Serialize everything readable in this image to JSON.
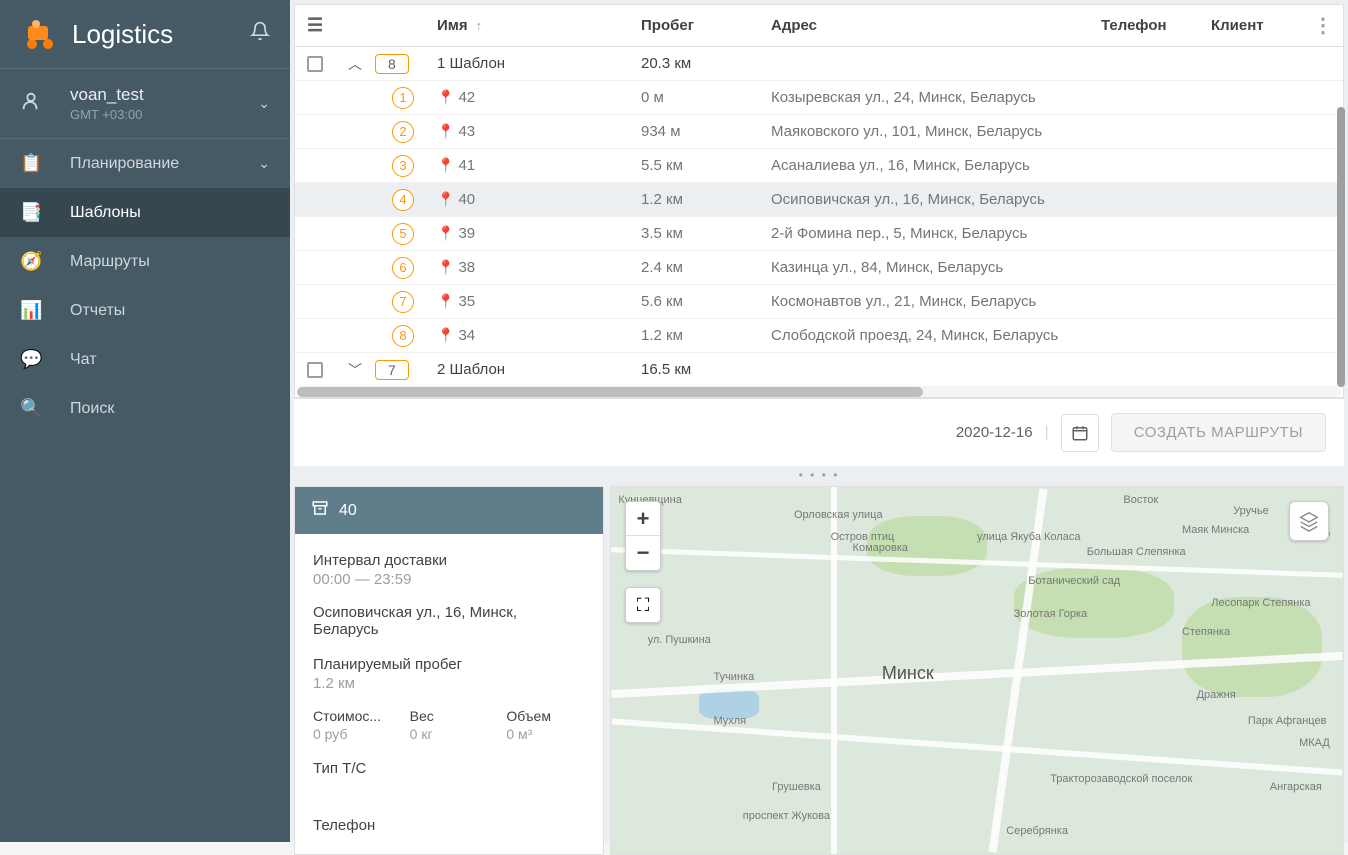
{
  "app": {
    "title": "Logistics"
  },
  "user": {
    "name": "voan_test",
    "tz": "GMT +03:00"
  },
  "nav": {
    "planning": "Планирование",
    "templates": "Шаблоны",
    "routes": "Маршруты",
    "reports": "Отчеты",
    "chat": "Чат",
    "search": "Поиск"
  },
  "table": {
    "headers": {
      "name": "Имя",
      "mileage": "Пробег",
      "address": "Адрес",
      "phone": "Телефон",
      "client": "Клиент"
    },
    "groups": [
      {
        "badge": "8",
        "name": "1 Шаблон",
        "mileage": "20.3 км",
        "expanded": true,
        "rows": [
          {
            "n": "1",
            "name": "42",
            "mileage": "0 м",
            "address": "Козыревская ул., 24, Минск, Беларусь"
          },
          {
            "n": "2",
            "name": "43",
            "mileage": "934 м",
            "address": "Маяковского ул., 101, Минск, Беларусь"
          },
          {
            "n": "3",
            "name": "41",
            "mileage": "5.5 км",
            "address": "Асаналиева ул., 16, Минск, Беларусь"
          },
          {
            "n": "4",
            "name": "40",
            "mileage": "1.2 км",
            "address": "Осиповичская ул., 16, Минск, Беларусь",
            "hl": true
          },
          {
            "n": "5",
            "name": "39",
            "mileage": "3.5 км",
            "address": "2-й Фомина пер., 5, Минск, Беларусь"
          },
          {
            "n": "6",
            "name": "38",
            "mileage": "2.4 км",
            "address": "Казинца ул., 84, Минск, Беларусь"
          },
          {
            "n": "7",
            "name": "35",
            "mileage": "5.6 км",
            "address": "Космонавтов ул., 21, Минск, Беларусь"
          },
          {
            "n": "8",
            "name": "34",
            "mileage": "1.2 км",
            "address": "Слободской проезд, 24, Минск, Беларусь"
          }
        ]
      },
      {
        "badge": "7",
        "name": "2 Шаблон",
        "mileage": "16.5 км",
        "expanded": false,
        "rows": []
      }
    ]
  },
  "actions": {
    "date": "2020-12-16",
    "create": "СОЗДАТЬ МАРШРУТЫ"
  },
  "detail": {
    "title": "40",
    "interval_label": "Интервал доставки",
    "interval_value": "00:00 — 23:59",
    "address": "Осиповичская ул., 16, Минск, Беларусь",
    "planned_label": "Планируемый пробег",
    "planned_value": "1.2 км",
    "cost_label": "Стоимос...",
    "cost_value": "0 руб",
    "weight_label": "Вес",
    "weight_value": "0 кг",
    "volume_label": "Объем",
    "volume_value": "0 м³",
    "vehicle_label": "Тип Т/С",
    "phone_label": "Телефон"
  },
  "map": {
    "city": "Минск",
    "labels": [
      "Кунцевщина",
      "Орловская улица",
      "Комаровка",
      "Золотая Горка",
      "Ботанический сад",
      "Большая Слепянка",
      "Степянка",
      "Лесопарк Степянка",
      "Восток",
      "Уручье",
      "Маяк Минска",
      "Дражня",
      "Парк Афганцев",
      "Ангарская",
      "Тракторозаводской поселок",
      "Серебрянка",
      "Грушевка",
      "Тучинка",
      "Мухля",
      "проспект Жукова",
      "Остров птиц",
      "улица Якуба Коласа",
      "ул. Пушкина",
      "МКАД",
      "МКАД"
    ]
  }
}
